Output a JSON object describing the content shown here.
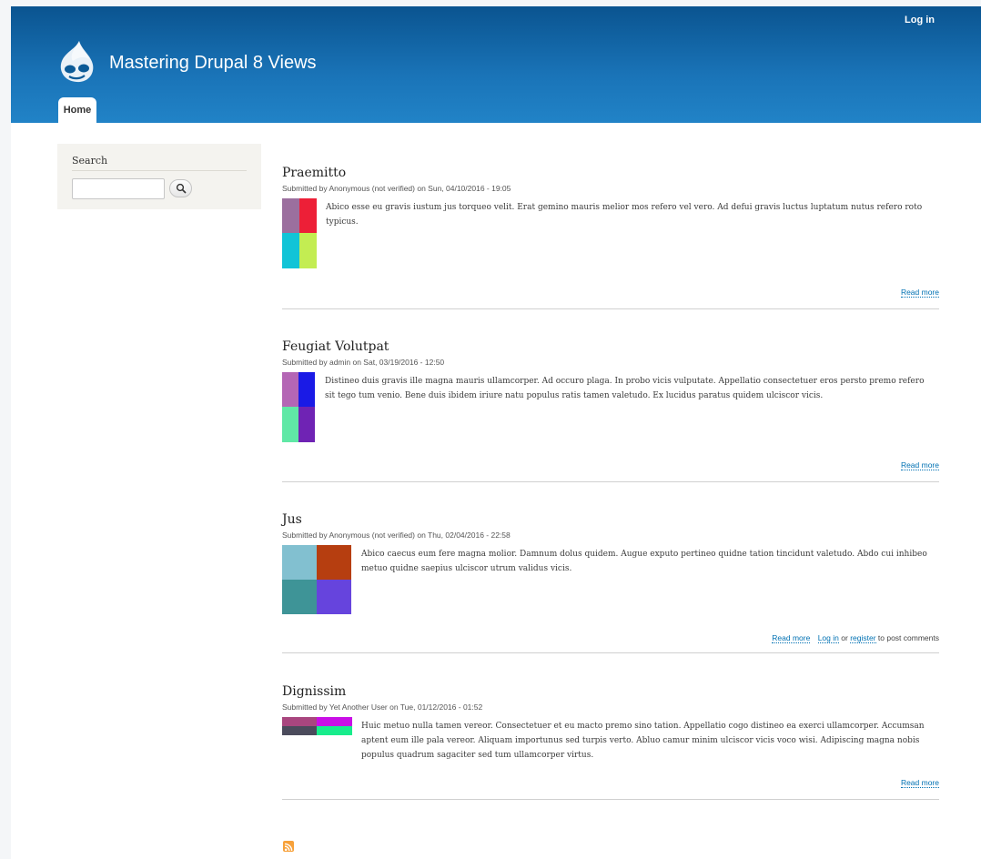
{
  "header": {
    "login_label": "Log in",
    "site_name": "Mastering Drupal 8 Views",
    "nav": {
      "home_label": "Home"
    },
    "brand_color": "#1a74b8"
  },
  "sidebar": {
    "search": {
      "title": "Search",
      "input_value": "",
      "button_icon": "search-icon"
    }
  },
  "articles": [
    {
      "title": "Praemitto",
      "meta": "Submitted by Anonymous (not verified) on Sun, 04/10/2016 - 19:05",
      "body": "Abico esse eu gravis iustum jus torqueo velit. Erat gemino mauris melior mos refero vel vero. Ad defui gravis luctus luptatum nutus refero roto typicus.",
      "read_more": "Read more",
      "thumb_colors": [
        "#9b6f9e",
        "#ed1f37",
        "#11c4d7",
        "#c3ed52"
      ]
    },
    {
      "title": "Feugiat Volutpat",
      "meta": "Submitted by admin on Sat, 03/19/2016 - 12:50",
      "body": "Distineo duis gravis ille magna mauris ullamcorper. Ad occuro plaga. In probo vicis vulputate. Appellatio consectetuer eros persto premo refero sit tego tum venio. Bene duis ibidem iriure natu populus ratis tamen valetudo. Ex lucidus paratus quidem ulciscor vicis.",
      "read_more": "Read more",
      "thumb_colors": [
        "#b466b5",
        "#1a1ae6",
        "#60e8a6",
        "#6f23b4"
      ]
    },
    {
      "title": "Jus",
      "meta": "Submitted by Anonymous (not verified) on Thu, 02/04/2016 - 22:58",
      "body": "Abico caecus eum fere magna molior. Damnum dolus quidem. Augue exputo pertineo quidne tation tincidunt valetudo. Abdo cui inhibeo metuo quidne saepius ulciscor utrum validus vicis.",
      "read_more": "Read more",
      "login_label": "Log in",
      "or_text": "or",
      "register_label": "register",
      "comment_suffix": "to post comments",
      "thumb_colors": [
        "#82c0d0",
        "#b63e10",
        "#3e9497",
        "#6644dd"
      ]
    },
    {
      "title": "Dignissim",
      "meta": "Submitted by Yet Another User on Tue, 01/12/2016 - 01:52",
      "body": "Huic metuo nulla tamen vereor. Consectetuer et eu macto premo sino tation. Appellatio cogo distineo ea exerci ullamcorper. Accumsan aptent eum ille pala vereor. Aliquam importunus sed turpis verto. Abluo camur minim ulciscor vicis voco wisi. Adipiscing magna nobis populus quadrum sagaciter sed tum ullamcorper virtus.",
      "read_more": "Read more",
      "thumb_colors": [
        "#a9467f",
        "#c90fe6",
        "#4b4b5c",
        "#18ec8c"
      ]
    }
  ],
  "footer": {
    "feed_icon": "rss-icon",
    "feed_color": "#f7a13a"
  }
}
